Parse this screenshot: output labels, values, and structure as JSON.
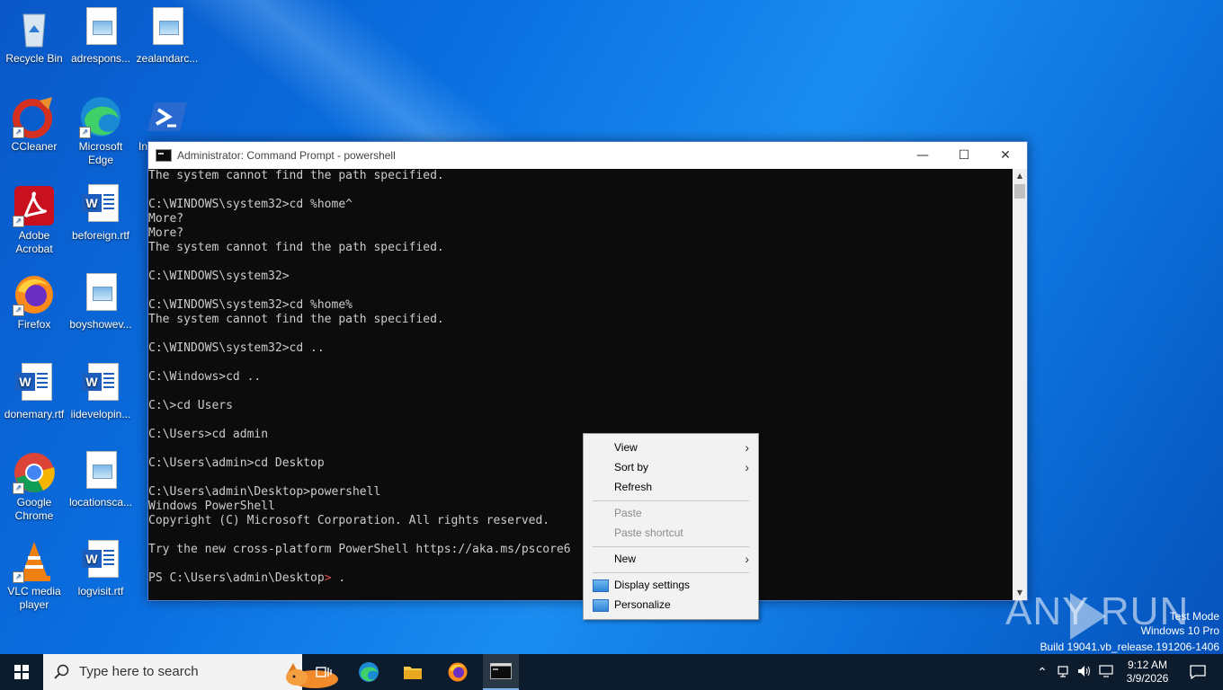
{
  "desktop": {
    "icons": [
      {
        "label": "Recycle Bin"
      },
      {
        "label": "adrespons..."
      },
      {
        "label": "zealandarc..."
      },
      {
        "label": "CCleaner"
      },
      {
        "label": "Microsoft Edge"
      },
      {
        "label": "In"
      },
      {
        "label": "Adobe Acrobat"
      },
      {
        "label": "beforeign.rtf"
      },
      {
        "label": "Firefox"
      },
      {
        "label": "boyshowev..."
      },
      {
        "label": "donemary.rtf"
      },
      {
        "label": "iidevelopin..."
      },
      {
        "label": "Google Chrome"
      },
      {
        "label": "locationsca..."
      },
      {
        "label": "VLC media player"
      },
      {
        "label": "logvisit.rtf"
      }
    ]
  },
  "cmd_window": {
    "title": "Administrator: Command Prompt - powershell",
    "lines": [
      "The system cannot find the path specified.",
      "",
      "C:\\WINDOWS\\system32>cd %home^",
      "More?",
      "More?",
      "The system cannot find the path specified.",
      "",
      "C:\\WINDOWS\\system32>",
      "",
      "C:\\WINDOWS\\system32>cd %home%",
      "The system cannot find the path specified.",
      "",
      "C:\\WINDOWS\\system32>cd ..",
      "",
      "C:\\Windows>cd ..",
      "",
      "C:\\>cd Users",
      "",
      "C:\\Users>cd admin",
      "",
      "C:\\Users\\admin>cd Desktop",
      "",
      "C:\\Users\\admin\\Desktop>powershell",
      "Windows PowerShell",
      "Copyright (C) Microsoft Corporation. All rights reserved.",
      "",
      "Try the new cross-platform PowerShell https://aka.ms/pscore6",
      ""
    ],
    "prompt": "PS C:\\Users\\admin\\Desktop",
    "prompt_arrow": ">",
    "prompt_input": " ."
  },
  "context_menu": {
    "view": "View",
    "sort_by": "Sort by",
    "refresh": "Refresh",
    "paste": "Paste",
    "paste_shortcut": "Paste shortcut",
    "new": "New",
    "display_settings": "Display settings",
    "personalize": "Personalize"
  },
  "watermark": {
    "brand": "ANY RUN",
    "test_mode": "Test Mode",
    "edition": "Windows 10 Pro",
    "build": "Build 19041.vb_release.191206-1406"
  },
  "taskbar": {
    "search_placeholder": "Type here to search",
    "time": "9:12 AM",
    "date": "3/9/2026"
  }
}
